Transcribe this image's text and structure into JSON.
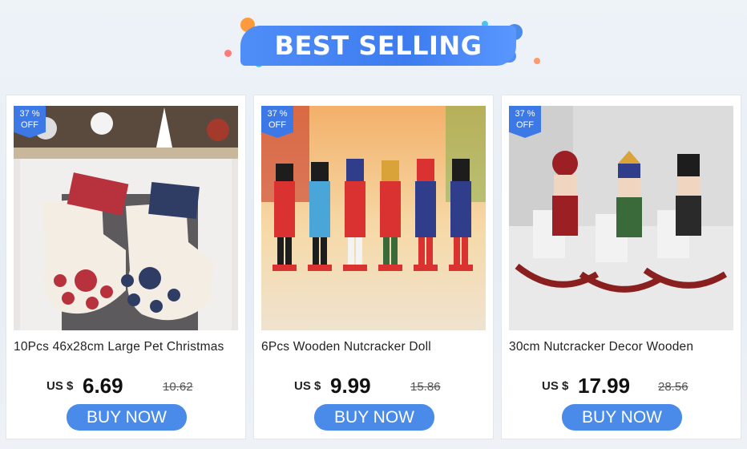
{
  "banner": {
    "title": "BEST SELLING"
  },
  "products": [
    {
      "discount": "37 %",
      "discount_suffix": "OFF",
      "title": "10Pcs 46x28cm Large Pet Christmas",
      "currency": "US $",
      "price": "6.69",
      "old_price": "10.62",
      "buy_label": "BUY NOW"
    },
    {
      "discount": "37 %",
      "discount_suffix": "OFF",
      "title": "6Pcs Wooden Nutcracker Doll",
      "currency": "US $",
      "price": "9.99",
      "old_price": "15.86",
      "buy_label": "BUY NOW"
    },
    {
      "discount": "37 %",
      "discount_suffix": "OFF",
      "title": "30cm Nutcracker Decor Wooden",
      "currency": "US $",
      "price": "17.99",
      "old_price": "28.56",
      "buy_label": "BUY NOW"
    }
  ],
  "colors": {
    "accent": "#4a8ae8",
    "badge": "#3c78e6"
  }
}
